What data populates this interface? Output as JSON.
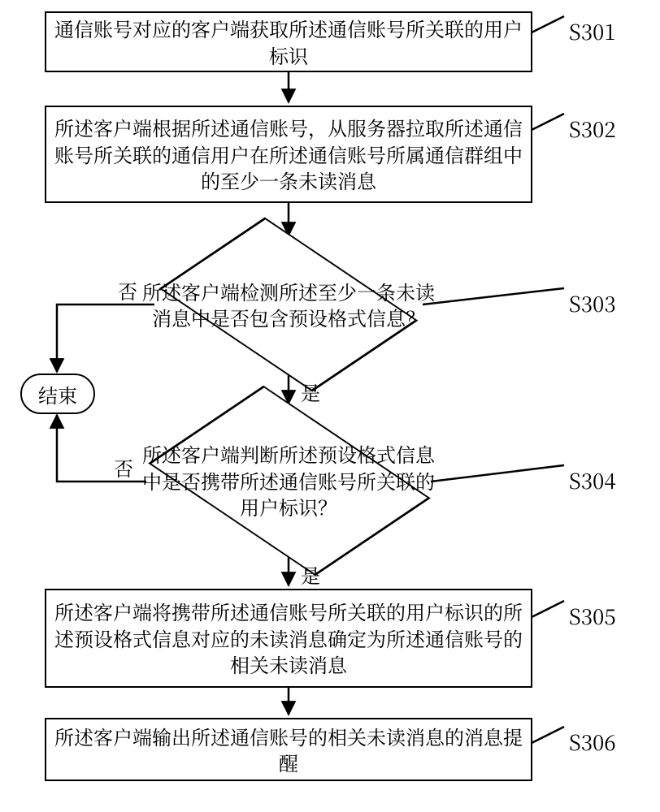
{
  "steps": {
    "s301": {
      "code": "S301",
      "text": "通信账号对应的客户端获取所述通信账号所关联的用户标识"
    },
    "s302": {
      "code": "S302",
      "text": "所述客户端根据所述通信账号，从服务器拉取所述通信账号所关联的通信用户在所述通信账号所属通信群组中的至少一条未读消息"
    },
    "s303": {
      "code": "S303",
      "text": "所述客户端检测所述至少一条未读消息中是否包含预设格式信息？"
    },
    "s304": {
      "code": "S304",
      "text": "所述客户端判断所述预设格式信息中是否携带所述通信账号所关联的用户标识？"
    },
    "s305": {
      "code": "S305",
      "text": "所述客户端将携带所述通信账号所关联的用户标识的所述预设格式信息对应的未读消息确定为所述通信账号的相关未读消息"
    },
    "s306": {
      "code": "S306",
      "text": "所述客户端输出所述通信账号的相关未读消息的消息提醒"
    }
  },
  "terminal": {
    "end": "结束"
  },
  "edgeLabels": {
    "yes": "是",
    "no": "否"
  }
}
